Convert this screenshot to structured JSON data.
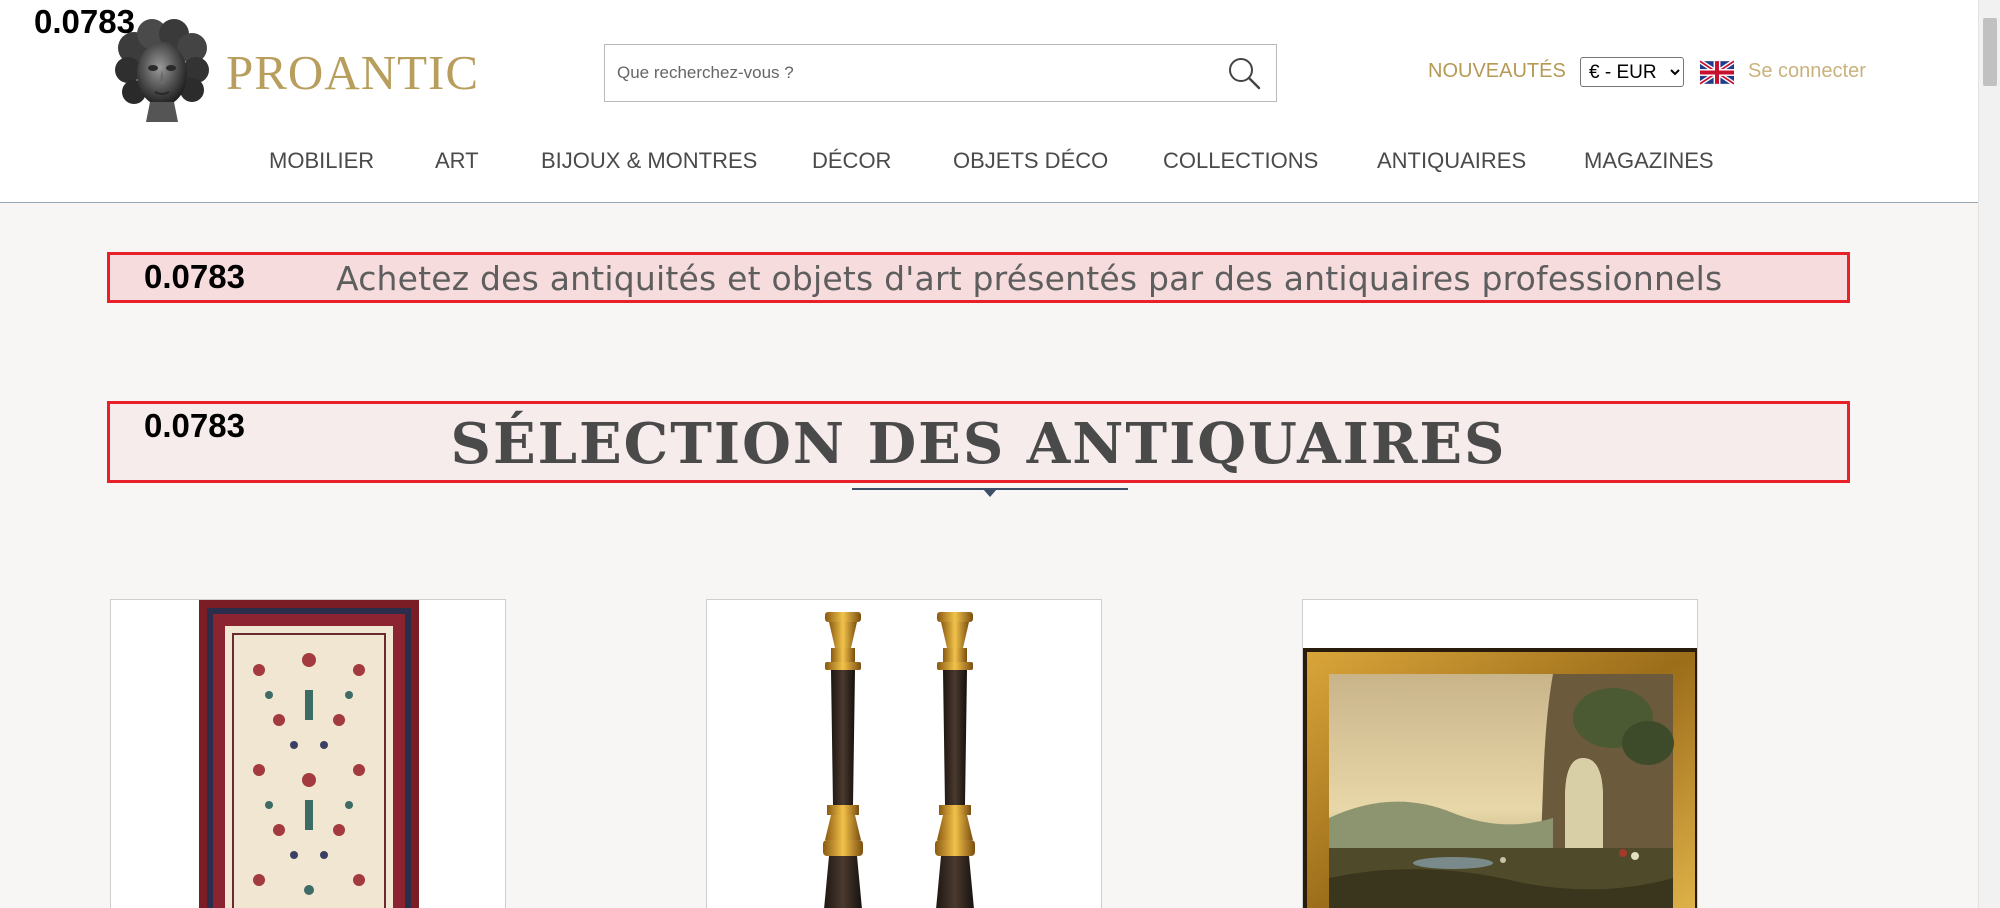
{
  "overlay": {
    "score_label": "0.0783"
  },
  "header": {
    "logo_text": "PROANTIC",
    "logo_icon": "classical-bust-logo",
    "search": {
      "placeholder": "Que recherchez-vous ?",
      "value": "",
      "icon": "search-icon"
    },
    "new_arrivals_label": "NOUVEAUTÉS",
    "currency": {
      "selected": "€ - EUR",
      "options": [
        "€ - EUR"
      ]
    },
    "language_icon": "uk-flag-icon",
    "login_label": "Se connecter"
  },
  "nav": {
    "items": [
      {
        "label": "MOBILIER"
      },
      {
        "label": "ART"
      },
      {
        "label": "BIJOUX & MONTRES"
      },
      {
        "label": "DÉCOR"
      },
      {
        "label": "OBJETS DÉCO"
      },
      {
        "label": "COLLECTIONS"
      },
      {
        "label": "ANTIQUAIRES"
      },
      {
        "label": "MAGAZINES"
      }
    ]
  },
  "main": {
    "tagline": {
      "score_label": "0.0783",
      "text": "Achetez des antiquités et objets d'art présentés par des antiquaires professionnels"
    },
    "selection": {
      "score_label": "0.0783",
      "title": "SÉLECTION DES ANTIQUAIRES"
    },
    "products": [
      {
        "image": "persian-rug"
      },
      {
        "image": "pair-of-candlesticks"
      },
      {
        "image": "framed-landscape-painting"
      }
    ]
  },
  "colors": {
    "brand_gold": "#b89e5c",
    "login_gold": "#c9b27e",
    "highlight_border": "#e8202a",
    "highlight_fill": "#f6dcdd",
    "nav_underline": "#3c4f67",
    "page_bg": "#f7f6f4"
  }
}
